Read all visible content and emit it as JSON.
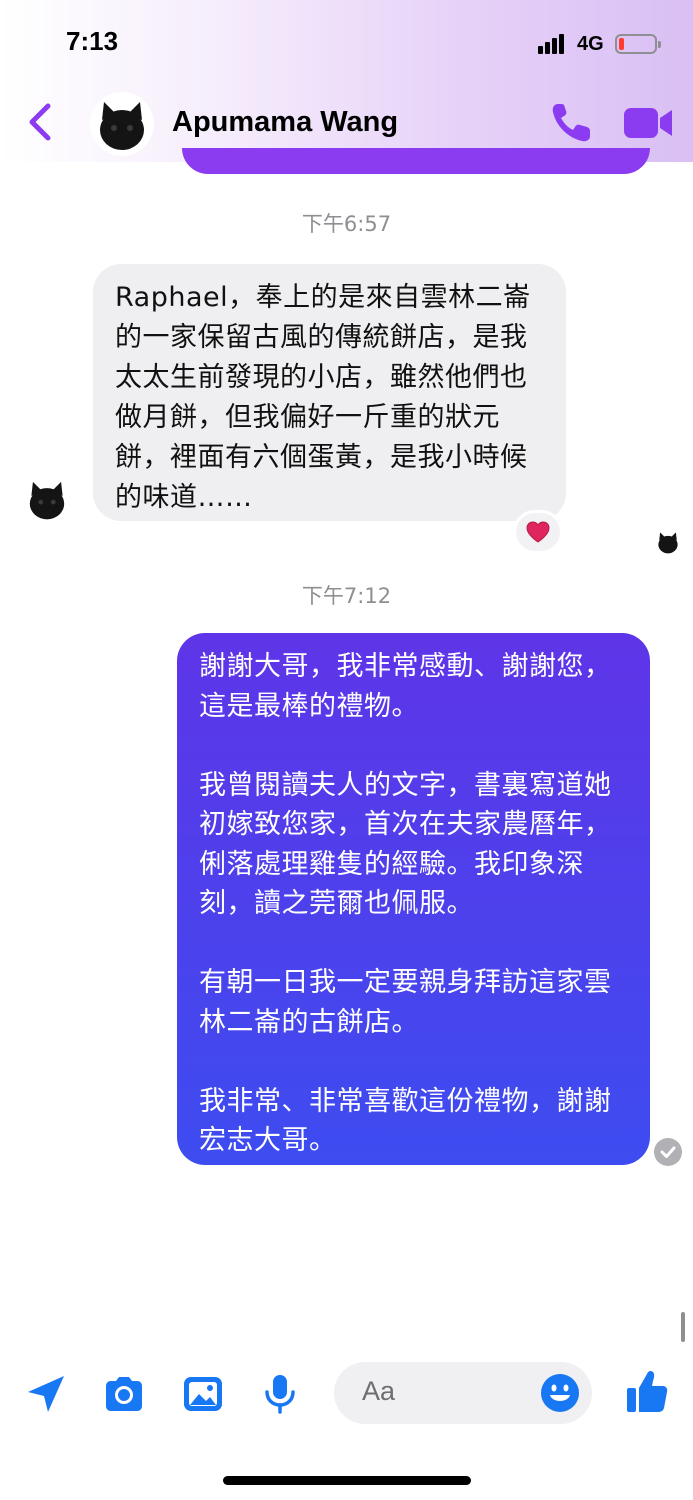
{
  "status_bar": {
    "time": "7:13",
    "network": "4G",
    "battery_level": 0.1
  },
  "header": {
    "contact_name": "Apumama Wang"
  },
  "messages": [
    {
      "timestamp": "下午6:57",
      "direction": "incoming",
      "text": "Raphael，奉上的是來自雲林二崙的一家保留古風的傳統餅店，是我太太生前發現的小店，雖然他們也做月餅，但我偏好一斤重的狀元餅，裡面有六個蛋黃，是我小時候的味道……",
      "reaction": "❤️"
    },
    {
      "timestamp": "下午7:12",
      "direction": "outgoing",
      "text": "謝謝大哥，我非常感動、謝謝您，這是最棒的禮物。\n\n我曾閱讀夫人的文字，書裏寫道她初嫁致您家，首次在夫家農曆年，俐落處理雞隻的經驗。我印象深刻，讀之莞爾也佩服。\n\n有朝一日我一定要親身拜訪這家雲林二崙的古餅店。\n\n我非常、非常喜歡這份禮物，謝謝宏志大哥。"
    }
  ],
  "composer": {
    "placeholder": "Aa"
  },
  "colors": {
    "accent": "#8b3cf0",
    "outgoing_start": "#5e35e8",
    "outgoing_end": "#3d4cf0",
    "composer_icons": "#1877f2"
  },
  "icons": [
    "back-chevron-icon",
    "phone-icon",
    "video-camera-icon",
    "location-arrow-icon",
    "camera-icon",
    "image-icon",
    "microphone-icon",
    "emoji-icon",
    "thumbs-up-icon",
    "read-check-icon"
  ]
}
